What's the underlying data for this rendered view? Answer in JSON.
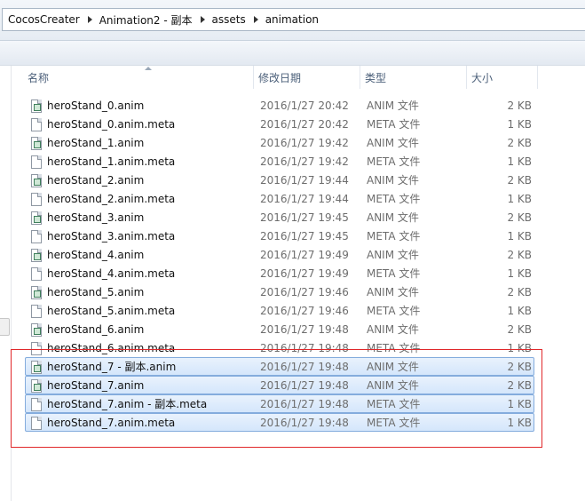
{
  "address_bar": {
    "crumbs": [
      "CocosCreater",
      "Animation2 - 副本",
      "assets",
      "animation"
    ]
  },
  "columns": {
    "name": "名称",
    "date": "修改日期",
    "type": "类型",
    "size": "大小"
  },
  "files": [
    {
      "name": "heroStand_0.anim",
      "date": "2016/1/27 20:42",
      "type": "ANIM 文件",
      "size": "2 KB",
      "icon": "anim-file-icon",
      "selected": false
    },
    {
      "name": "heroStand_0.anim.meta",
      "date": "2016/1/27 20:42",
      "type": "META 文件",
      "size": "1 KB",
      "icon": "blank-file-icon",
      "selected": false
    },
    {
      "name": "heroStand_1.anim",
      "date": "2016/1/27 19:42",
      "type": "ANIM 文件",
      "size": "2 KB",
      "icon": "anim-file-icon",
      "selected": false
    },
    {
      "name": "heroStand_1.anim.meta",
      "date": "2016/1/27 19:42",
      "type": "META 文件",
      "size": "1 KB",
      "icon": "blank-file-icon",
      "selected": false
    },
    {
      "name": "heroStand_2.anim",
      "date": "2016/1/27 19:44",
      "type": "ANIM 文件",
      "size": "2 KB",
      "icon": "anim-file-icon",
      "selected": false
    },
    {
      "name": "heroStand_2.anim.meta",
      "date": "2016/1/27 19:44",
      "type": "META 文件",
      "size": "1 KB",
      "icon": "blank-file-icon",
      "selected": false
    },
    {
      "name": "heroStand_3.anim",
      "date": "2016/1/27 19:45",
      "type": "ANIM 文件",
      "size": "2 KB",
      "icon": "anim-file-icon",
      "selected": false
    },
    {
      "name": "heroStand_3.anim.meta",
      "date": "2016/1/27 19:45",
      "type": "META 文件",
      "size": "1 KB",
      "icon": "blank-file-icon",
      "selected": false
    },
    {
      "name": "heroStand_4.anim",
      "date": "2016/1/27 19:49",
      "type": "ANIM 文件",
      "size": "2 KB",
      "icon": "anim-file-icon",
      "selected": false
    },
    {
      "name": "heroStand_4.anim.meta",
      "date": "2016/1/27 19:49",
      "type": "META 文件",
      "size": "1 KB",
      "icon": "blank-file-icon",
      "selected": false
    },
    {
      "name": "heroStand_5.anim",
      "date": "2016/1/27 19:46",
      "type": "ANIM 文件",
      "size": "2 KB",
      "icon": "anim-file-icon",
      "selected": false
    },
    {
      "name": "heroStand_5.anim.meta",
      "date": "2016/1/27 19:46",
      "type": "META 文件",
      "size": "1 KB",
      "icon": "blank-file-icon",
      "selected": false
    },
    {
      "name": "heroStand_6.anim",
      "date": "2016/1/27 19:48",
      "type": "ANIM 文件",
      "size": "2 KB",
      "icon": "anim-file-icon",
      "selected": false
    },
    {
      "name": "heroStand_6.anim.meta",
      "date": "2016/1/27 19:48",
      "type": "META 文件",
      "size": "1 KB",
      "icon": "blank-file-icon",
      "selected": false
    },
    {
      "name": "heroStand_7 - 副本.anim",
      "date": "2016/1/27 19:48",
      "type": "ANIM 文件",
      "size": "2 KB",
      "icon": "anim-file-icon",
      "selected": true
    },
    {
      "name": "heroStand_7.anim",
      "date": "2016/1/27 19:48",
      "type": "ANIM 文件",
      "size": "2 KB",
      "icon": "anim-file-icon",
      "selected": true
    },
    {
      "name": "heroStand_7.anim - 副本.meta",
      "date": "2016/1/27 19:48",
      "type": "META 文件",
      "size": "1 KB",
      "icon": "blank-file-icon",
      "selected": true
    },
    {
      "name": "heroStand_7.anim.meta",
      "date": "2016/1/27 19:48",
      "type": "META 文件",
      "size": "1 KB",
      "icon": "blank-file-icon",
      "selected": true
    }
  ],
  "colors": {
    "selection_fill": "#d9e8fb",
    "selection_border": "#84acdd",
    "annotation_box": "#e0272a"
  }
}
